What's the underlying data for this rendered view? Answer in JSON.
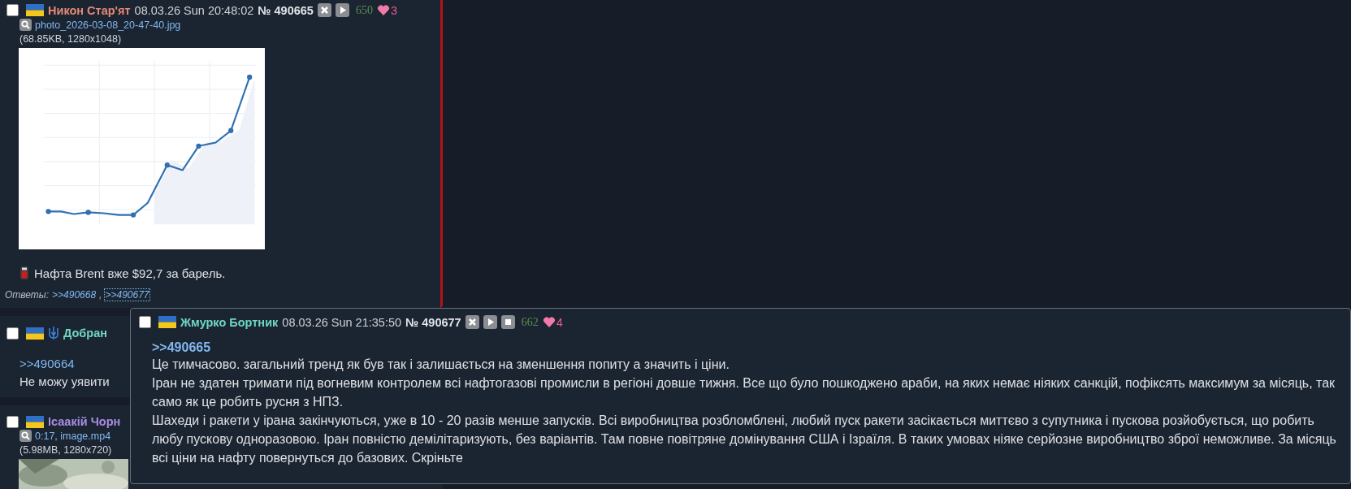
{
  "posts": [
    {
      "name": "Никон Стар'ят",
      "color": "#e58a76",
      "emblem": false,
      "checked": false,
      "date": "08.03.26 Sun 20:48:02",
      "number": "№ 490665",
      "controls": [
        {
          "kind": "hide"
        },
        {
          "kind": "play"
        }
      ],
      "score": "650",
      "likes": "3",
      "file": {
        "name": "photo_2026-03-08_20-47-40.jpg",
        "info": "(68.85KB, 1280x1048)",
        "kind": "chart-picture"
      },
      "body": [
        {
          "kind": "fuel-text",
          "text": "Нафта Brent вже $92,7 за барель."
        }
      ],
      "replies_label": "Ответы:",
      "replies": [
        {
          "text": ">>490668",
          "hovered": false,
          "separator": ","
        },
        {
          "text": ">>490677",
          "hovered": true
        }
      ]
    },
    {
      "name": "Добран",
      "color": "#6fd6c4",
      "emblem": true,
      "checked": false,
      "body": [
        {
          "kind": "quote",
          "text": ">>490664"
        },
        {
          "kind": "text",
          "text": "Не можу уявити"
        }
      ]
    },
    {
      "name": "Ісаакій Чорн",
      "color": "#a98de0",
      "emblem": false,
      "checked": false,
      "file": {
        "name": "0:17, image.mp4",
        "info": "(5.98MB, 1280x720)",
        "kind": "video-picture"
      }
    }
  ],
  "popup": {
    "name": "Жмурко Бортник",
    "color": "#6fd6c4",
    "emblem": false,
    "checked": false,
    "date": "08.03.26 Sun 21:35:50",
    "number": "№ 490677",
    "controls": [
      {
        "kind": "hide"
      },
      {
        "kind": "play"
      },
      {
        "kind": "stop"
      }
    ],
    "score": "662",
    "likes": "4",
    "body": [
      {
        "kind": "quote",
        "text": ">>490665"
      },
      {
        "kind": "text",
        "text": "Це тимчасово. загальний тренд як був так і залишається на зменшення попиту а значить і ціни."
      },
      {
        "kind": "text",
        "text": "Іран не здатен тримати під вогневим контролем всі нафтогазові промисли в регіоні довше тижня. Все що було пошкоджено араби, на яких немає ніяких санкцій, пофіксять максимум за місяць, так само як це робить русня з НПЗ."
      },
      {
        "kind": "text",
        "text": "Шахеди і ракети у ірана закінчуються, уже в 10 - 20 разів менше запусків. Всі виробництва розбломблені, любий пуск ракети засікається миттєво з супутника і пускова розйобується, що робить любу пускову одноразовою. Іран повністю демілітаризують, без варіантів. Там повне повітряне домінування США і Ізраїля. В таких умовах ніяке серйозне виробництво зброї неможливе. За місяць всі ціни на нафту повернуться до базових. Скріньте"
      }
    ]
  }
}
